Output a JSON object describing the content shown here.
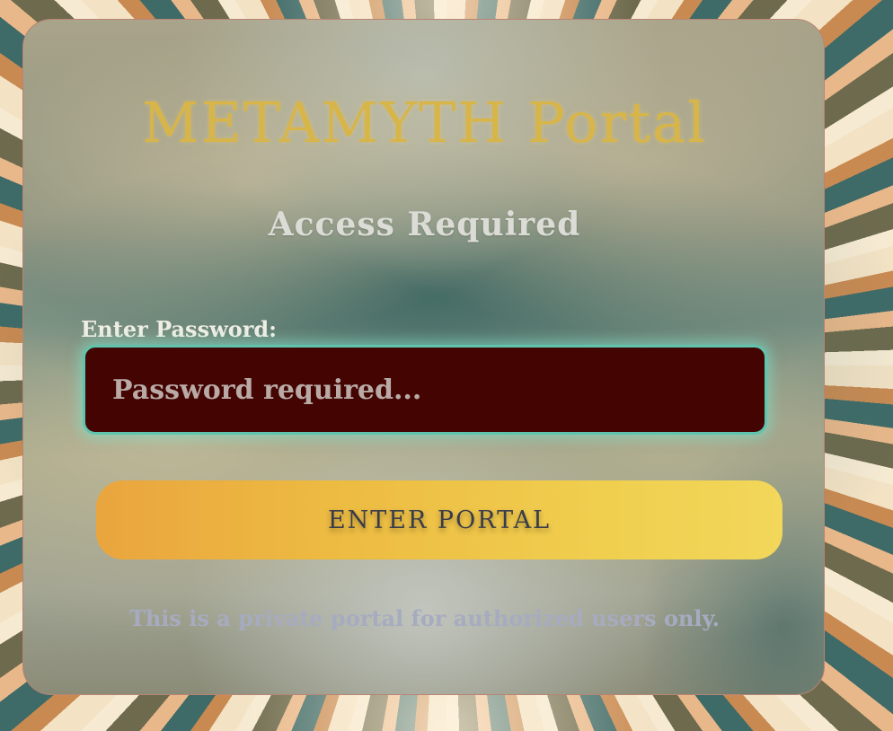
{
  "portal": {
    "title": "METAMYTH Portal",
    "subtitle": "Access Required"
  },
  "login_form": {
    "password_label": "Enter Password:",
    "password_value": "",
    "password_placeholder": "Password required...",
    "submit_label": "ENTER PORTAL"
  },
  "footer": {
    "notice": "This is a private portal for authorized users only."
  },
  "colors": {
    "title_gold": "#d8b548",
    "input_background": "#430402",
    "input_border_glow": "#5fc3ad",
    "button_gradient_start": "#eaa53e",
    "button_gradient_end": "#f2d75a",
    "button_text": "#3a3c4a",
    "notice_text": "#a6abc0",
    "card_border": "#b98474"
  }
}
